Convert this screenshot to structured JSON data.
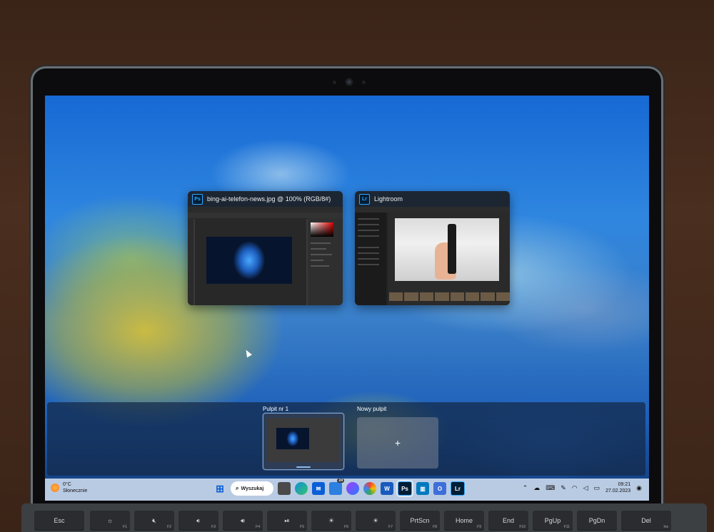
{
  "windows": [
    {
      "title": "bing-ai-telefon-news.jpg @ 100% (RGB/8#)",
      "app_badge": "Ps"
    },
    {
      "title": "Lightroom",
      "app_badge": "Lr"
    }
  ],
  "desktops": {
    "desktop1_label": "Pulpit nr 1",
    "new_desktop_label": "Nowy pulpit",
    "new_desktop_icon": "+"
  },
  "taskbar": {
    "weather_temp": "0°C",
    "weather_desc": "Słonecznie",
    "search_label": "Wyszukaj",
    "badge_count": "24",
    "time": "09:21",
    "date": "27.02.2023",
    "ps_label": "Ps",
    "lr_label": "Lr"
  },
  "keys": {
    "esc": "Esc",
    "f1": "F1",
    "f2": "F2",
    "f3": "F3",
    "f4": "F4",
    "f5": "F5",
    "f6": "F6",
    "f7": "F7",
    "f8": "F8",
    "f9": "F9",
    "f10": "F10",
    "f11": "F11",
    "prtscn": "PrtScn",
    "home": "Home",
    "end": "End",
    "pgup": "PgUp",
    "pgdn": "PgDn",
    "del": "Del",
    "ins": "Ins"
  }
}
